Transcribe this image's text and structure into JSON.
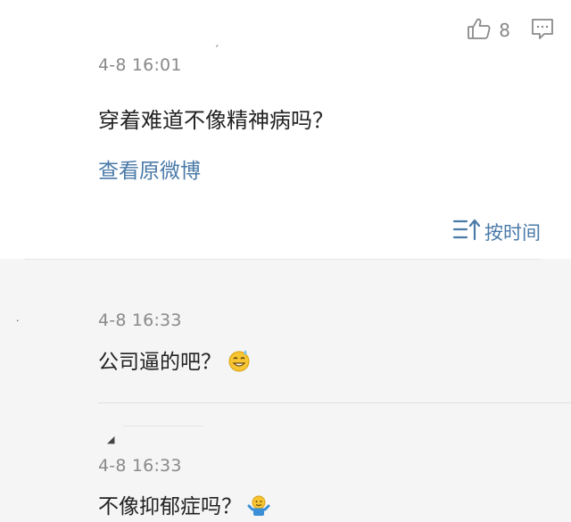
{
  "post": {
    "like_count": "8",
    "time": "4-8 16:01",
    "text": "穿着难道不像精神病吗？",
    "view_link": "查看原微博"
  },
  "sort": {
    "label": "按时间"
  },
  "comments": [
    {
      "time": "4-8 16:33",
      "text": "公司逼的吧？",
      "emoji": "sweat-smile-emoji"
    },
    {
      "time": "4-8 16:33",
      "text": "不像抑郁症吗？",
      "emoji": "shrug-emoji"
    }
  ],
  "icons": {
    "like": "thumbs-up-icon",
    "comment": "comment-icon",
    "sort": "sort-icon"
  },
  "colors": {
    "link": "#4a7aa8",
    "meta": "#8a8a8a",
    "text": "#222222",
    "comment_bg": "#f5f5f5"
  }
}
